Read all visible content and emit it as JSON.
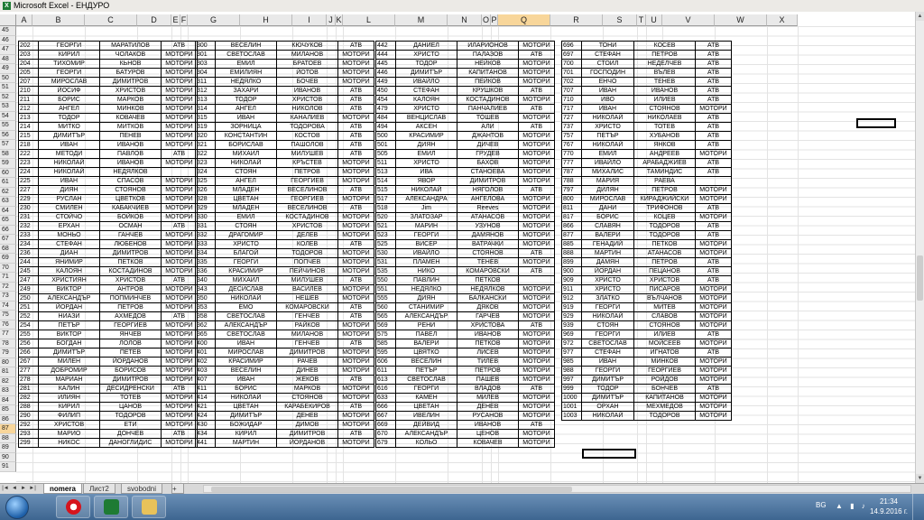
{
  "window": {
    "title": "Microsoft Excel - ЕНДУРО"
  },
  "columns": [
    "A",
    "B",
    "C",
    "D",
    "E",
    "F",
    "G",
    "H",
    "I",
    "J",
    "K",
    "L",
    "M",
    "N",
    "O",
    "P",
    "Q",
    "R",
    "S",
    "T",
    "U",
    "V",
    "W",
    "X"
  ],
  "selected_column": "Q",
  "rows": [
    "45",
    "46",
    "47",
    "48",
    "49",
    "50",
    "51",
    "52",
    "53",
    "54",
    "55",
    "56",
    "57",
    "58",
    "59",
    "60",
    "61",
    "62",
    "63",
    "64",
    "65",
    "66",
    "67",
    "68",
    "69",
    "70",
    "71",
    "72",
    "73",
    "74",
    "75",
    "76",
    "77",
    "78",
    "79",
    "80",
    "81",
    "82",
    "83",
    "84",
    "85",
    "86",
    "87",
    "88",
    "89",
    "90",
    "91"
  ],
  "selected_row": "87",
  "tables": [
    [
      [
        "202",
        "ГЕОРГИ",
        "МАРАТИЛОВ",
        "АТВ"
      ],
      [
        "203",
        "КИРИЛ",
        "ЧОЛАКОВ",
        "МОТОРИ"
      ],
      [
        "204",
        "ТИХОМИР",
        "КЬНОВ",
        "МОТОРИ"
      ],
      [
        "205",
        "ГЕОРГИ",
        "БАТУРОВ",
        "МОТОРИ"
      ],
      [
        "207",
        "МИРОСЛАВ",
        "ДИМИТРОВ",
        "МОТОРИ"
      ],
      [
        "210",
        "ЙОСИФ",
        "ХРИСТОВ",
        "МОТОРИ"
      ],
      [
        "211",
        "БОРИС",
        "МАРКОВ",
        "МОТОРИ"
      ],
      [
        "212",
        "АНГЕЛ",
        "МИНКОВ",
        "МОТОРИ"
      ],
      [
        "213",
        "ТОДОР",
        "КОВАЧЕВ",
        "МОТОРИ"
      ],
      [
        "214",
        "МИТКО",
        "МИТКОВ",
        "МОТОРИ"
      ],
      [
        "215",
        "ДИМИТЪР",
        "ПЕНЕВ",
        "МОТОРИ"
      ],
      [
        "218",
        "ИВАН",
        "ИВАНОВ",
        "МОТОРИ"
      ],
      [
        "222",
        "МЕТОДИ",
        "ПАВЛОВ",
        "АТВ"
      ],
      [
        "223",
        "НИКОЛАЙ",
        "ИВАНОВ",
        "МОТОРИ"
      ],
      [
        "224",
        "НИКОЛАЙ",
        "НЕДЯЛКОВ",
        ""
      ],
      [
        "225",
        "ИВАН",
        "СПАСОВ",
        "МОТОРИ"
      ],
      [
        "227",
        "ДИЯН",
        "СТОЯНОВ",
        "МОТОРИ"
      ],
      [
        "229",
        "РУСЛАН",
        "ЦВЕТКОВ",
        "МОТОРИ"
      ],
      [
        "230",
        "СМИЛЕН",
        "КАБАКЧИЕВ",
        "МОТОРИ"
      ],
      [
        "231",
        "СТОЙЧО",
        "БОЙКОВ",
        "МОТОРИ"
      ],
      [
        "232",
        "ЕРХАН",
        "ОСМАН",
        "АТВ"
      ],
      [
        "233",
        "МОНЬО",
        "ГАНЧЕВ",
        "МОТОРИ"
      ],
      [
        "234",
        "СТЕФАН",
        "ЛЮБЕНОВ",
        "МОТОРИ"
      ],
      [
        "236",
        "ДИАН",
        "ДИМИТРОВ",
        "МОТОРИ"
      ],
      [
        "244",
        "ЯНИМИР",
        "ПЕТКОВ",
        "МОТОРИ"
      ],
      [
        "245",
        "КАЛОЯН",
        "КОСТАДИНОВ",
        "МОТОРИ"
      ],
      [
        "247",
        "ХРИСТИЯН",
        "ХРИСТОВ",
        "АТВ"
      ],
      [
        "249",
        "ВИКТОР",
        "АНТРОВ",
        "МОТОРИ"
      ],
      [
        "250",
        "АЛЕКСАНДЪР",
        "ПОПМИНЧЕВ",
        "МОТОРИ"
      ],
      [
        "251",
        "ЙОРДАН",
        "ПЕТРОВ",
        "МОТОРИ"
      ],
      [
        "252",
        "НИАЗИ",
        "АХМЕДОВ",
        "АТВ"
      ],
      [
        "254",
        "ПЕТЪР",
        "ГЕОРГИЕВ",
        "МОТОРИ"
      ],
      [
        "255",
        "ВИКТОР",
        "ЯНЧЕВ",
        "МОТОРИ"
      ],
      [
        "256",
        "БОГДАН",
        "ЛОЛОВ",
        "МОТОРИ"
      ],
      [
        "266",
        "ДИМИТЪР",
        "ПЕТЕВ",
        "МОТОРИ"
      ],
      [
        "267",
        "МИЛЕН",
        "ЙОРДАНОВ",
        "МОТОРИ"
      ],
      [
        "277",
        "ДОБРОМИР",
        "БОРИСОВ",
        "МОТОРИ"
      ],
      [
        "278",
        "МАРИАН",
        "ДИМИТРОВ",
        "МОТОРИ"
      ],
      [
        "281",
        "КАЛИН",
        "ДЕСИДРЕНСКИ",
        "АТВ"
      ],
      [
        "282",
        "ИЛИЯН",
        "ТОТЕВ",
        "МОТОРИ"
      ],
      [
        "288",
        "КИРИЛ",
        "ЦАНОВ",
        "МОТОРИ"
      ],
      [
        "290",
        "ФИЛИП",
        "ТОДОРОВ",
        "МОТОРИ"
      ],
      [
        "292",
        "ХРИСТОВ",
        "ЕТИ",
        "МОТОРИ"
      ],
      [
        "293",
        "МАРИО",
        "ДОНЧЕВ",
        "АТВ"
      ],
      [
        "299",
        "НИКОС",
        "ДАНОГЛИДИС",
        "МОТОРИ"
      ]
    ],
    [
      [
        "300",
        "ВЕСЕЛИН",
        "КЮЧУКОВ",
        "АТВ"
      ],
      [
        "301",
        "СВЕТОСЛАВ",
        "МИЛАНОВ",
        "МОТОРИ"
      ],
      [
        "303",
        "ЕМИЛ",
        "БРАТОЕВ",
        "МОТОРИ"
      ],
      [
        "304",
        "ЕМИЛИЯН",
        "ЙОТОВ",
        "МОТОРИ"
      ],
      [
        "311",
        "НЕДЯЛКО",
        "БОЧЕВ",
        "МОТОРИ"
      ],
      [
        "312",
        "ЗАХАРИ",
        "ИВАНОВ",
        "АТВ"
      ],
      [
        "313",
        "ТОДОР",
        "ХРИСТОВ",
        "АТВ"
      ],
      [
        "314",
        "АНГЕЛ",
        "НИКОЛОВ",
        "АТВ"
      ],
      [
        "315",
        "ИВАН",
        "КАНАЛИЕВ",
        "МОТОРИ"
      ],
      [
        "319",
        "ЗОРНИЦА",
        "ТОДОРОВА",
        "АТВ"
      ],
      [
        "320",
        "КОНСТАНТИН",
        "КОСТОВ",
        "АТВ"
      ],
      [
        "321",
        "БОРИСЛАВ",
        "ПАШОЛОВ",
        "АТВ"
      ],
      [
        "322",
        "МИХАИЛ",
        "МИЛУШЕВ",
        "АТВ"
      ],
      [
        "323",
        "НИКОЛАЙ",
        "КРЪСТЕВ",
        "МОТОРИ"
      ],
      [
        "324",
        "СТОЯН",
        "ПЕТРОВ",
        "МОТОРИ"
      ],
      [
        "325",
        "АНГЕЛ",
        "ГЕОРГИЕВ",
        "МОТОРИ"
      ],
      [
        "326",
        "МЛАДЕН",
        "ВЕСЕЛИНОВ",
        "АТВ"
      ],
      [
        "328",
        "ЦВЕТАН",
        "ГЕОРГИЕВ",
        "МОТОРИ"
      ],
      [
        "329",
        "МЛАДЕН",
        "ВЕСЕЛИНОВ",
        "АТВ"
      ],
      [
        "330",
        "ЕМИЛ",
        "КОСТАДИНОВ",
        "МОТОРИ"
      ],
      [
        "331",
        "СТОЯН",
        "ХРИСТОВ",
        "МОТОРИ"
      ],
      [
        "332",
        "ДРАГОМИР",
        "ДЕЛЕВ",
        "МОТОРИ"
      ],
      [
        "333",
        "ХРИСТО",
        "КОЛЕВ",
        "АТВ"
      ],
      [
        "334",
        "БЛАГОЙ",
        "ТОДОРОВ",
        "МОТОРИ"
      ],
      [
        "335",
        "ГЕОРГИ",
        "ПОПЧЕВ",
        "МОТОРИ"
      ],
      [
        "336",
        "КРАСИМИР",
        "ПЕЙЧИНОВ",
        "МОТОРИ"
      ],
      [
        "340",
        "МИХАИЛ",
        "МИЛУШЕВ",
        "АТВ"
      ],
      [
        "343",
        "ДЕСИСЛАВ",
        "ВАСИЛЕВ",
        "МОТОРИ"
      ],
      [
        "350",
        "НИКОЛАЙ",
        "НЕШЕВ",
        "МОТОРИ"
      ],
      [
        "353",
        "ЕМО",
        "КОМАРОВСКИ",
        "АТВ"
      ],
      [
        "358",
        "СВЕТОСЛАВ",
        "ГЕНЧЕВ",
        "АТВ"
      ],
      [
        "362",
        "АЛЕКСАНДЪР",
        "РАЙКОВ",
        "МОТОРИ"
      ],
      [
        "365",
        "СВЕТОСЛАВ",
        "МИЛАНОВ",
        "МОТОРИ"
      ],
      [
        "400",
        "ИВАН",
        "ГЕНЧЕВ",
        "АТВ"
      ],
      [
        "401",
        "МИРОСЛАВ",
        "ДИМИТРОВ",
        "МОТОРИ"
      ],
      [
        "402",
        "КРАСИМИР",
        "РАЧЕВ",
        "МОТОРИ"
      ],
      [
        "403",
        "ВЕСЕЛИН",
        "ДИНЕВ",
        "МОТОРИ"
      ],
      [
        "407",
        "ИВАН",
        "ЖЕКОВ",
        "АТВ"
      ],
      [
        "411",
        "БОРИС",
        "МАРКОВ",
        "МОТОРИ"
      ],
      [
        "414",
        "НИКОЛАЙ",
        "СТОЯНОВ",
        "МОТОРИ"
      ],
      [
        "421",
        "ЦВЕТАН",
        "КАРАБЕКИРОВ",
        "АТВ"
      ],
      [
        "424",
        "ДИМИТЪР",
        "ДЕНЕВ",
        "МОТОРИ"
      ],
      [
        "430",
        "БОЖИДАР",
        "ДИМОВ",
        "МОТОРИ"
      ],
      [
        "434",
        "КИРИЛ",
        "ДИМИТРОВ",
        "АТВ"
      ],
      [
        "441",
        "МАРТИН",
        "ЙОРДАНОВ",
        "МОТОРИ"
      ]
    ],
    [
      [
        "442",
        "ДАНИЕЛ",
        "ИЛАРИОНОВ",
        "МОТОРИ"
      ],
      [
        "444",
        "ХРИСТО",
        "ПАЛАЗОВ",
        "АТВ"
      ],
      [
        "445",
        "ТОДОР",
        "НЕЙКОВ",
        "МОТОРИ"
      ],
      [
        "446",
        "ДИМИТЪР",
        "КАПИТАНОВ",
        "МОТОРИ"
      ],
      [
        "449",
        "ИВАЙЛО",
        "ПЕЙКОВ",
        "МОТОРИ"
      ],
      [
        "450",
        "СТЕФАН",
        "КРУШКОВ",
        "АТВ"
      ],
      [
        "454",
        "КАЛОЯН",
        "КОСТАДИНОВ",
        "МОТОРИ"
      ],
      [
        "479",
        "ХРИСТО",
        "ПАНЧАЛИЕВ",
        "АТВ"
      ],
      [
        "484",
        "ВЕНЦИСЛАВ",
        "ТОШЕВ",
        "МОТОРИ"
      ],
      [
        "494",
        "АКСЕН",
        "АЛИ",
        "АТВ"
      ],
      [
        "500",
        "КРАСИМИР",
        "ДЖАНТОВ",
        "МОТОРИ"
      ],
      [
        "501",
        "ДИЯН",
        "ДИЧЕВ",
        "МОТОРИ"
      ],
      [
        "505",
        "ЕМИЛ",
        "ГРУДЕВ",
        "МОТОРИ"
      ],
      [
        "511",
        "ХРИСТО",
        "БАХОВ",
        "МОТОРИ"
      ],
      [
        "513",
        "ИВА",
        "СТАНОЕВА",
        "МОТОРИ"
      ],
      [
        "514",
        "ЯВОР",
        "ДИМИТРОВ",
        "МОТОРИ"
      ],
      [
        "515",
        "НИКОЛАЙ",
        "НЯГОЛОВ",
        "АТВ"
      ],
      [
        "517",
        "АЛЕКСАНДРА",
        "АНГЕЛОВА",
        "МОТОРИ"
      ],
      [
        "518",
        "Jim",
        "Reeves",
        "МОТОРИ"
      ],
      [
        "520",
        "ЗЛАТОЗАР",
        "АТАНАСОВ",
        "МОТОРИ"
      ],
      [
        "521",
        "МАРИН",
        "УЗУНОВ",
        "МОТОРИ"
      ],
      [
        "523",
        "ГЕОРГИ",
        "ДАМЯНОВ",
        "МОТОРИ"
      ],
      [
        "525",
        "ВИСЕР",
        "ВАТРАЧКИ",
        "МОТОРИ"
      ],
      [
        "530",
        "ИВАЙЛО",
        "СТОЯНОВ",
        "АТВ"
      ],
      [
        "531",
        "ПЛАМЕН",
        "ТЕНЕВ",
        "МОТОРИ"
      ],
      [
        "535",
        "НИКО",
        "КОМАРОВСКИ",
        "АТВ"
      ],
      [
        "550",
        "ПАВЛИН",
        "ПЕТКОВ",
        ""
      ],
      [
        "551",
        "НЕДЯЛКО",
        "НЕДЯЛКОВ",
        "МОТОРИ"
      ],
      [
        "555",
        "ДИЯН",
        "БАЛКАНСКИ",
        "МОТОРИ"
      ],
      [
        "560",
        "СТАНИМИР",
        "ДЯКОВ",
        "МОТОРИ"
      ],
      [
        "565",
        "АЛЕКСАНДЪР",
        "ГАРЧЕВ",
        "МОТОРИ"
      ],
      [
        "569",
        "РЕНИ",
        "ХРИСТОВА",
        "АТВ"
      ],
      [
        "575",
        "ПАВЕЛ",
        "ИВАНОВ",
        "МОТОРИ"
      ],
      [
        "585",
        "ВАЛЕРИ",
        "ПЕТКОВ",
        "МОТОРИ"
      ],
      [
        "595",
        "ЦВЯТКО",
        "ЛИСЕВ",
        "МОТОРИ"
      ],
      [
        "606",
        "ВЕСЕЛИН",
        "ТИЛЕВ",
        "МОТОРИ"
      ],
      [
        "611",
        "ПЕТЪР",
        "ПЕТРОВ",
        "МОТОРИ"
      ],
      [
        "613",
        "СВЕТОСЛАВ",
        "ПАШЕВ",
        "МОТОРИ"
      ],
      [
        "616",
        "ГЕОРГИ",
        "ВЛАДОВ",
        "АТВ"
      ],
      [
        "633",
        "КАМЕН",
        "МИЛЕВ",
        "МОТОРИ"
      ],
      [
        "666",
        "ЦВЕТАН",
        "ДЕНЕВ",
        "МОТОРИ"
      ],
      [
        "667",
        "ИВЕЛИН",
        "РУСАНОВ",
        "МОТОРИ"
      ],
      [
        "669",
        "ДЕЙВИД",
        "ИВАНОВ",
        "АТВ"
      ],
      [
        "670",
        "АЛЕКСАНДЪР",
        "ЦЕНОВ",
        "МОТОРИ"
      ],
      [
        "679",
        "КОЛЬО",
        "КОВАЧЕВ",
        "МОТОРИ"
      ]
    ],
    [
      [
        "696",
        "ТОНИ",
        "КОСЕВ",
        "АТВ"
      ],
      [
        "697",
        "СТЕФАН",
        "ПЕТРОВ",
        "АТВ"
      ],
      [
        "700",
        "СТОИЛ",
        "НЕДЕЛЧЕВ",
        "АТВ"
      ],
      [
        "701",
        "ГОСПОДИН",
        "ВЪЛЕВ",
        "АТВ"
      ],
      [
        "702",
        "ЕНЧО",
        "ТЕНЕВ",
        "АТВ"
      ],
      [
        "707",
        "ИВАН",
        "ИВАНОВ",
        "АТВ"
      ],
      [
        "710",
        "ИВО",
        "ИЛИЕВ",
        "АТВ"
      ],
      [
        "717",
        "ИВАН",
        "СТОЯНОВ",
        "МОТОРИ"
      ],
      [
        "727",
        "НИКОЛАЙ",
        "НИКОЛАЕВ",
        "АТВ"
      ],
      [
        "737",
        "ХРИСТО",
        "ТОТЕВ",
        "АТВ"
      ],
      [
        "757",
        "ПЕТЪР",
        "ХУБАНОВ",
        "АТВ"
      ],
      [
        "767",
        "НИКОЛАЙ",
        "ЯНКОВ",
        "АТВ"
      ],
      [
        "770",
        "ЕМИЛ",
        "АНДРЕЕВ",
        "МОТОРИ"
      ],
      [
        "777",
        "ИВАЙЛО",
        "АРАБАДЖИЕВ",
        "АТВ"
      ],
      [
        "787",
        "МИХАЛИС",
        "ТАМИНДИС",
        "АТВ"
      ],
      [
        "788",
        "МАРИЯ",
        "РАЕВА",
        ""
      ],
      [
        "797",
        "ДИЛЯН",
        "ПЕТРОВ",
        "МОТОРИ"
      ],
      [
        "800",
        "МИРОСЛАВ",
        "КИРАДЖИЙСКИ",
        "МОТОРИ"
      ],
      [
        "811",
        "ДАНИ",
        "ТРИФОНОВ",
        "АТВ"
      ],
      [
        "817",
        "БОРИС",
        "КОЦЕВ",
        "МОТОРИ"
      ],
      [
        "866",
        "СЛАВЯН",
        "ТОДОРОВ",
        "АТВ"
      ],
      [
        "877",
        "ВАЛЕРИ",
        "ТОДОРОВ",
        "АТВ"
      ],
      [
        "885",
        "ГЕНАДИЙ",
        "ПЕТКОВ",
        "МОТОРИ"
      ],
      [
        "888",
        "МАРТИН",
        "АТАНАСОВ",
        "МОТОРИ"
      ],
      [
        "899",
        "ДАМЯН",
        "ПЕТРОВ",
        "АТВ"
      ],
      [
        "900",
        "ЙОРДАН",
        "ПЕЦАНОВ",
        "АТВ"
      ],
      [
        "909",
        "ХРИСТО",
        "ХРИСТОВ",
        "АТВ"
      ],
      [
        "911",
        "ХРИСТО",
        "ПИСАРОВ",
        "МОТОРИ"
      ],
      [
        "912",
        "ЗЛАТКО",
        "ВЪЛЧАНОВ",
        "МОТОРИ"
      ],
      [
        "919",
        "ГЕОРГИ",
        "МИТЕВ",
        "МОТОРИ"
      ],
      [
        "929",
        "НИКОЛАЙ",
        "СЛАВОВ",
        "МОТОРИ"
      ],
      [
        "939",
        "СТОЯН",
        "СТОЯНОВ",
        "МОТОРИ"
      ],
      [
        "969",
        "ГЕОРГИ",
        "ИЛИЕВ",
        "АТВ"
      ],
      [
        "972",
        "СВЕТОСЛАВ",
        "МОЙСЕЕВ",
        "МОТОРИ"
      ],
      [
        "977",
        "СТЕФАН",
        "ИГНАТОВ",
        "АТВ"
      ],
      [
        "985",
        "ИВАН",
        "МИНКОВ",
        "МОТОРИ"
      ],
      [
        "988",
        "ГЕОРГИ",
        "ГЕОРГИЕВ",
        "МОТОРИ"
      ],
      [
        "997",
        "ДИМИТЪР",
        "РОЙДОВ",
        "МОТОРИ"
      ],
      [
        "999",
        "ТОДОР",
        "БОНЧЕВ",
        "АТВ"
      ],
      [
        "1000",
        "ДИМИТЪР",
        "КАПИТАНОВ",
        "МОТОРИ"
      ],
      [
        "1001",
        "ОРХАН",
        "МЕХМЕДОВ",
        "МОТОРИ"
      ],
      [
        "1003",
        "НИКОЛАЙ",
        "ТОДОРОВ",
        "МОТОРИ"
      ]
    ]
  ],
  "sheet_tabs": [
    "nomera",
    "Лист2",
    "svobodni"
  ],
  "active_tab": "nomera",
  "tray": {
    "language": "BG",
    "time": "21:34",
    "date": "14.9.2016 г."
  }
}
